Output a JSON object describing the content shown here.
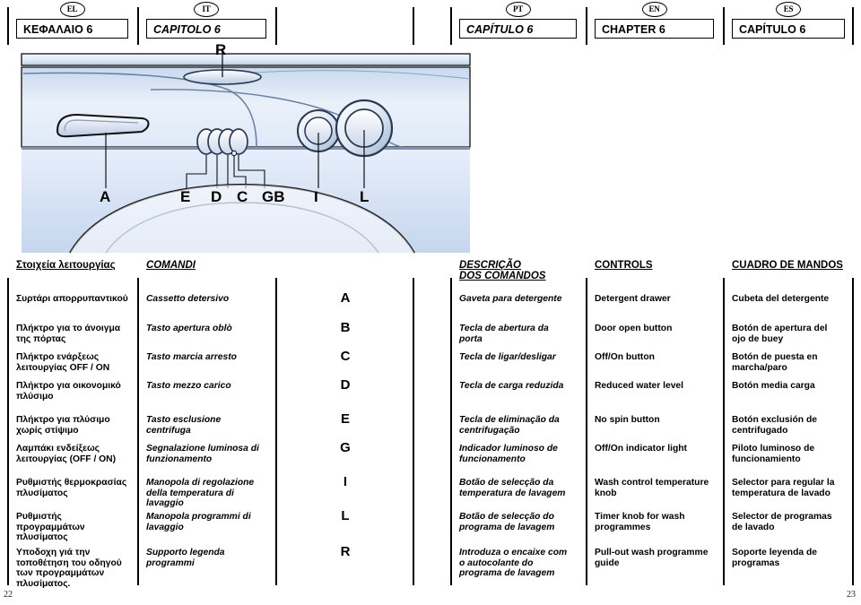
{
  "languages": [
    {
      "code": "EL",
      "title": "ΚΕΦΑΛΑΙΟ 6",
      "italic": false
    },
    {
      "code": "IT",
      "title": "CAPITOLO 6",
      "italic": true
    },
    {
      "code": "PT",
      "title": "CAPÍTULO 6",
      "italic": true
    },
    {
      "code": "EN",
      "title": "CHAPTER 6",
      "italic": false
    },
    {
      "code": "ES",
      "title": "CAPÍTULO 6",
      "italic": false
    }
  ],
  "illustration": {
    "callouts": [
      "R",
      "A",
      "E",
      "D",
      "C",
      "GB",
      "I",
      "L"
    ],
    "alt": "washing-machine-control-panel"
  },
  "table": {
    "headers": {
      "el": "Στοιχεία λειτουργίας",
      "it": "COMANDI",
      "pt_line1": "DESCRIÇÃO",
      "pt_line2": "DOS COMANDOS",
      "en": "CONTROLS",
      "es": "CUADRO DE MANDOS"
    },
    "rows": [
      {
        "letter": "A",
        "el": "Συρτάρι απορρυπαντικού",
        "it": "Cassetto detersivo",
        "pt": "Gaveta para detergente",
        "en": "Detergent drawer",
        "es": "Cubeta del detergente"
      },
      {
        "letter": "B",
        "el": "Πλήκτρο για το άνοιγμα της πόρτας",
        "it": "Tasto apertura oblò",
        "pt": "Tecla de abertura da porta",
        "en": "Door open button",
        "es": "Botón de apertura del ojo de buey"
      },
      {
        "letter": "C",
        "el": "Πλήκτρο ενάρξεως λειτουργίας OFF / ON",
        "it": "Tasto marcia arresto",
        "pt": "Tecla de ligar/desligar",
        "en": "Off/On button",
        "es": "Botón de puesta en marcha/paro"
      },
      {
        "letter": "D",
        "el": "Πλήκτρο για οικονομικό πλύσιμο",
        "it": "Tasto mezzo carico",
        "pt": "Tecla de carga reduzida",
        "en": "Reduced water level",
        "es": "Botón media carga"
      },
      {
        "letter": "E",
        "el": "Πλήκτρο για πλύσιμο χωρίς στίψιμο",
        "it": "Tasto esclusione centrifuga",
        "pt": "Tecla de eliminação da centrifugação",
        "en": "No spin button",
        "es": "Botón exclusión de centrifugado"
      },
      {
        "letter": "G",
        "el": "Λαμπάκι ενδείξεως λειτουργίας (OFF / ON)",
        "it": "Segnalazione luminosa di funzionamento",
        "pt": "Indicador luminoso de funcionamento",
        "en": "Off/On indicator light",
        "es": "Piloto luminoso de funcionamiento"
      },
      {
        "letter": "I",
        "el": "Ρυθμιστής θερμοκρασίας πλυσίματος",
        "it": "Manopola di regolazione della temperatura di lavaggio",
        "pt": "Botão de selecção da temperatura de lavagem",
        "en": "Wash control temperature knob",
        "es": "Selector para regular la temperatura de lavado"
      },
      {
        "letter": "L",
        "el": "Ρυθμιστής προγραμμάτων πλυσίματος",
        "it": "Manopola programmi di lavaggio",
        "pt": "Botão de selecção do programa de lavagem",
        "en": "Timer knob for wash programmes",
        "es": "Selector de programas de lavado"
      },
      {
        "letter": "R",
        "el": "Υποδοχη γιά την τοποθέτηση του οδηγού των προγραμμάτων πλυσίματος.",
        "it": "Supporto legenda programmi",
        "pt": "Introduza o encaixe com o autocolante do programa de lavagem",
        "en": "Pull-out wash programme guide",
        "es": "Soporte leyenda de programas"
      }
    ]
  },
  "footer": {
    "page_left": "22",
    "page_right": "23"
  },
  "colors": {
    "panel_light": "#eef3fb",
    "panel_mid": "#c9d7ec",
    "panel_dark": "#9fb4d4",
    "ink": "#000000"
  }
}
